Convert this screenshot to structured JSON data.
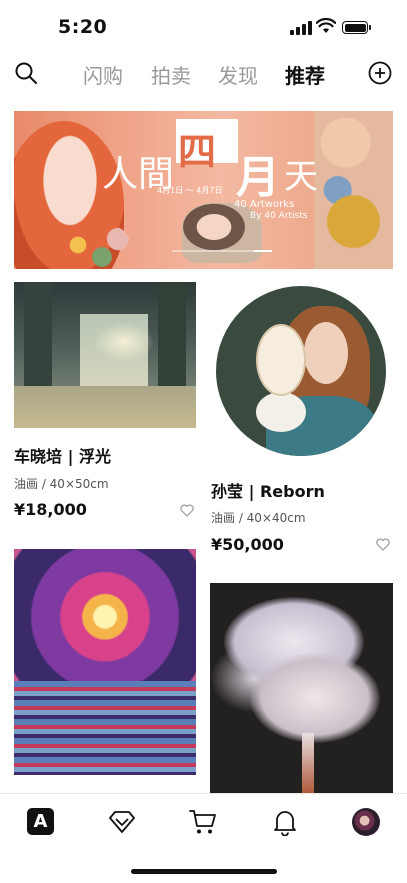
{
  "status_bar": {
    "time": "5:20"
  },
  "top_nav": {
    "tabs": [
      {
        "label": "闪购",
        "active": false
      },
      {
        "label": "拍卖",
        "active": false
      },
      {
        "label": "发现",
        "active": false
      },
      {
        "label": "推荐",
        "active": true
      }
    ],
    "search_icon": "search-icon",
    "add_icon": "plus-circle-icon"
  },
  "banner": {
    "title_part1": "人間",
    "title_part2": "四",
    "title_part3": "月",
    "title_part4": "天",
    "dates": "4月1日 ～ 4月7日",
    "artworks": "40 Artworks",
    "artists": "By 40 Artists"
  },
  "products": [
    {
      "title": "车晓培 | 浮光",
      "meta": "油画 / 40×50cm",
      "price": "¥18,000"
    },
    {
      "title": "孙莹 | Reborn",
      "meta": "油画 / 40×40cm",
      "price": "¥50,000"
    },
    {
      "title": "",
      "meta": "",
      "price": ""
    },
    {
      "title": "",
      "meta": "",
      "price": ""
    }
  ],
  "tab_bar": {
    "items": [
      {
        "name": "home",
        "icon": "logo-a-icon",
        "label": "A"
      },
      {
        "name": "gem",
        "icon": "diamond-icon"
      },
      {
        "name": "cart",
        "icon": "cart-icon"
      },
      {
        "name": "notifications",
        "icon": "bell-icon"
      },
      {
        "name": "profile",
        "icon": "avatar-icon"
      }
    ]
  }
}
